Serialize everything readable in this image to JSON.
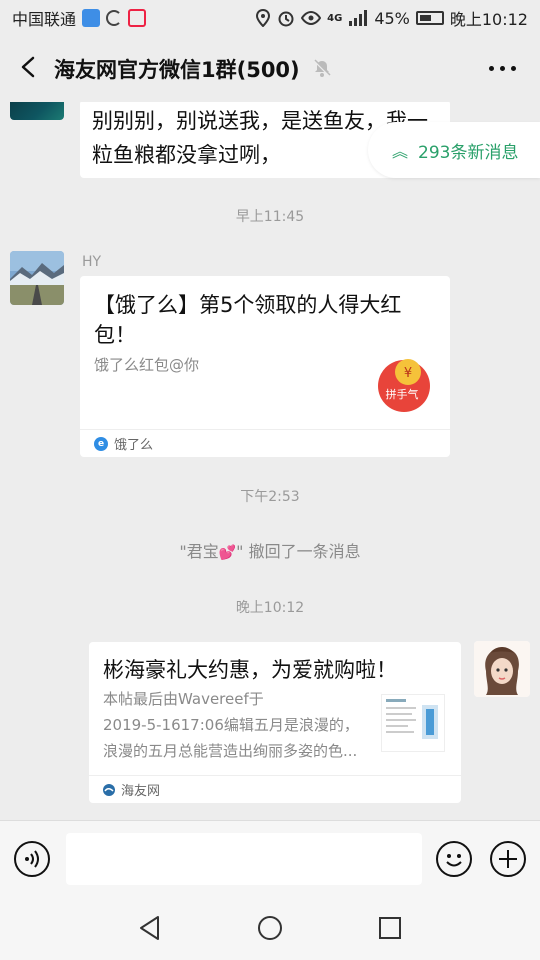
{
  "status_bar": {
    "carrier": "中国联通",
    "battery": "45%",
    "time": "晚上10:12",
    "network": "4G"
  },
  "header": {
    "title": "海友网官方微信1群(500)"
  },
  "new_messages": {
    "label": "293条新消息"
  },
  "messages": {
    "partial_text": "别别别，别说送我，是送鱼友，我一粒鱼粮都没拿过咧，",
    "time1": "早上11:45",
    "sender1": "HY",
    "card1": {
      "title": "【饿了么】第5个领取的人得大红包！",
      "desc": "饿了么红包@你",
      "badge": "拼手气",
      "source": "饿了么"
    },
    "time2": "下午2:53",
    "recall_prefix": "\"君宝",
    "recall_suffix": "\" 撤回了一条消息",
    "time3": "晚上10:12",
    "card2": {
      "title": "彬海豪礼大约惠，为爱就购啦！",
      "desc_line1": "本帖最后由Wavereef于",
      "desc_line2": "2019-5-1617:06编辑五月是浪漫的，",
      "desc_line3": "浪漫的五月总能营造出绚丽多姿的色...",
      "source": "海友网"
    }
  },
  "colors": {
    "background": "#ededed",
    "accent_green": "#2aa06a",
    "bubble": "#ffffff"
  }
}
